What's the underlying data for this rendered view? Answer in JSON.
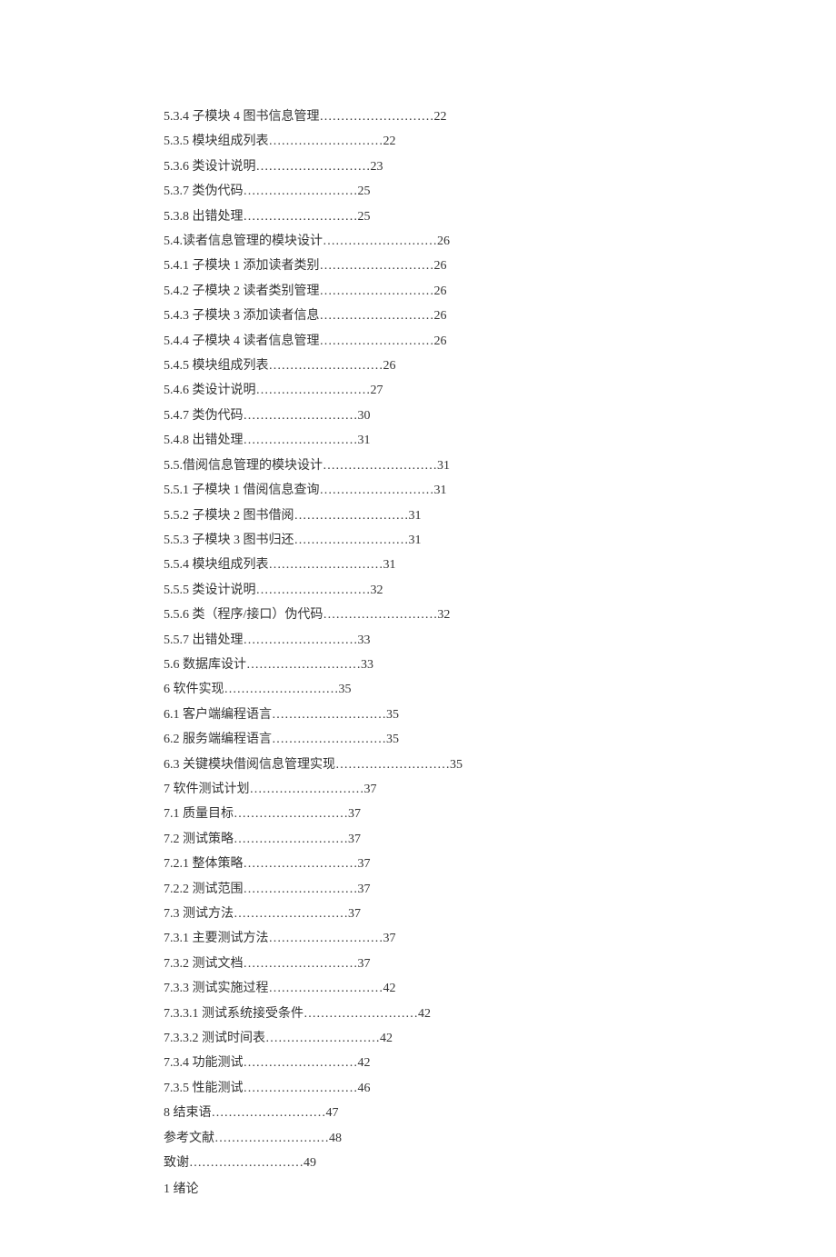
{
  "toc": [
    {
      "label": "5.3.4  子模块  4  图书信息管理",
      "page": "22"
    },
    {
      "label": "5.3.5  模块组成列表",
      "page": "22"
    },
    {
      "label": "5.3.6  类设计说明",
      "page": "23"
    },
    {
      "label": "5.3.7  类伪代码",
      "page": "25"
    },
    {
      "label": "5.3.8  出错处理",
      "page": "25"
    },
    {
      "label": "5.4.读者信息管理的模块设计",
      "page": "26"
    },
    {
      "label": "5.4.1  子模块 1  添加读者类别",
      "page": "26"
    },
    {
      "label": "5.4.2  子模块 2  读者类别管理",
      "page": "26"
    },
    {
      "label": "5.4.3  子模块  3  添加读者信息",
      "page": "26"
    },
    {
      "label": "5.4.4  子模块  4  读者信息管理",
      "page": "26"
    },
    {
      "label": "5.4.5  模块组成列表",
      "page": "26"
    },
    {
      "label": "5.4.6  类设计说明",
      "page": "27"
    },
    {
      "label": "5.4.7  类伪代码",
      "page": "30"
    },
    {
      "label": "5.4.8  出错处理",
      "page": "31"
    },
    {
      "label": "5.5.借阅信息管理的模块设计",
      "page": "31"
    },
    {
      "label": "5.5.1  子模块 1  借阅信息查询",
      "page": "31"
    },
    {
      "label": "5.5.2  子模块 2  图书借阅",
      "page": "31"
    },
    {
      "label": "5.5.3  子模块 3  图书归还",
      "page": "31"
    },
    {
      "label": "5.5.4  模块组成列表",
      "page": "31"
    },
    {
      "label": "5.5.5  类设计说明",
      "page": "32"
    },
    {
      "label": "5.5.6  类（程序/接口）伪代码",
      "page": "32"
    },
    {
      "label": "5.5.7  出错处理",
      "page": "33"
    },
    {
      "label": "5.6  数据库设计",
      "page": "33"
    },
    {
      "label": "6  软件实现",
      "page": "35"
    },
    {
      "label": "6.1  客户端编程语言",
      "page": "35"
    },
    {
      "label": "6.2  服务端编程语言",
      "page": "35"
    },
    {
      "label": "6.3  关键模块借阅信息管理实现",
      "page": "35"
    },
    {
      "label": "7  软件测试计划",
      "page": "37"
    },
    {
      "label": "7.1  质量目标",
      "page": "37"
    },
    {
      "label": "7.2  测试策略",
      "page": "37"
    },
    {
      "label": "7.2.1  整体策略",
      "page": "37"
    },
    {
      "label": "7.2.2  测试范围",
      "page": "37"
    },
    {
      "label": "7.3  测试方法",
      "page": "37"
    },
    {
      "label": "7.3.1  主要测试方法",
      "page": "37"
    },
    {
      "label": "7.3.2  测试文档",
      "page": "37"
    },
    {
      "label": "7.3.3  测试实施过程",
      "page": "42"
    },
    {
      "label": "7.3.3.1  测试系统接受条件",
      "page": "42"
    },
    {
      "label": "7.3.3.2  测试时间表",
      "page": "42"
    },
    {
      "label": "7.3.4  功能测试",
      "page": "42"
    },
    {
      "label": "7.3.5  性能测试",
      "page": "46"
    },
    {
      "label": "8  结束语",
      "page": "47"
    },
    {
      "label": "参考文献",
      "page": "48"
    },
    {
      "label": "致谢",
      "page": "49"
    }
  ],
  "section_heading": "1  绪论"
}
